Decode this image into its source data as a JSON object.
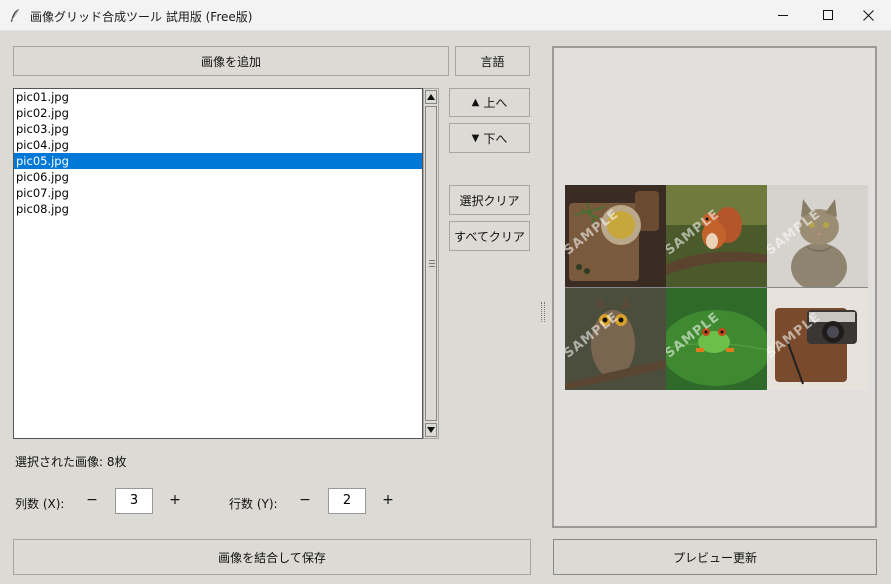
{
  "window": {
    "title": "画像グリッド合成ツール 試用版 (Free版)",
    "minimize_glyph": "—",
    "maximize_glyph": "☐",
    "close_glyph": "✕"
  },
  "toolbar": {
    "add_images_label": "画像を追加",
    "language_label": "言語"
  },
  "file_list": {
    "items": [
      "pic01.jpg",
      "pic02.jpg",
      "pic03.jpg",
      "pic04.jpg",
      "pic05.jpg",
      "pic06.jpg",
      "pic07.jpg",
      "pic08.jpg"
    ],
    "selected_index": 4
  },
  "side_buttons": {
    "move_up_label": "上へ",
    "move_up_arrow": "▲",
    "move_down_label": "下へ",
    "move_down_arrow": "▼",
    "clear_selection_label": "選択クリア",
    "clear_all_label": "すべてクリア"
  },
  "status": {
    "selected_count_text": "選択された画像: 8枚"
  },
  "grid_settings": {
    "columns_label": "列数 (X):",
    "columns_value": "3",
    "rows_label": "行数 (Y):",
    "rows_value": "2",
    "decrement_glyph": "−",
    "increment_glyph": "+"
  },
  "actions": {
    "merge_save_label": "画像を結合して保存",
    "preview_update_label": "プレビュー更新"
  },
  "preview": {
    "watermark_text": "SAMPLE",
    "tiles": [
      "olive-oil-board",
      "squirrel",
      "tabby-cat",
      "owl",
      "tree-frog",
      "camera-notebook"
    ]
  },
  "colors": {
    "selection": "#0078d7",
    "window_bg": "#dcdad5"
  }
}
